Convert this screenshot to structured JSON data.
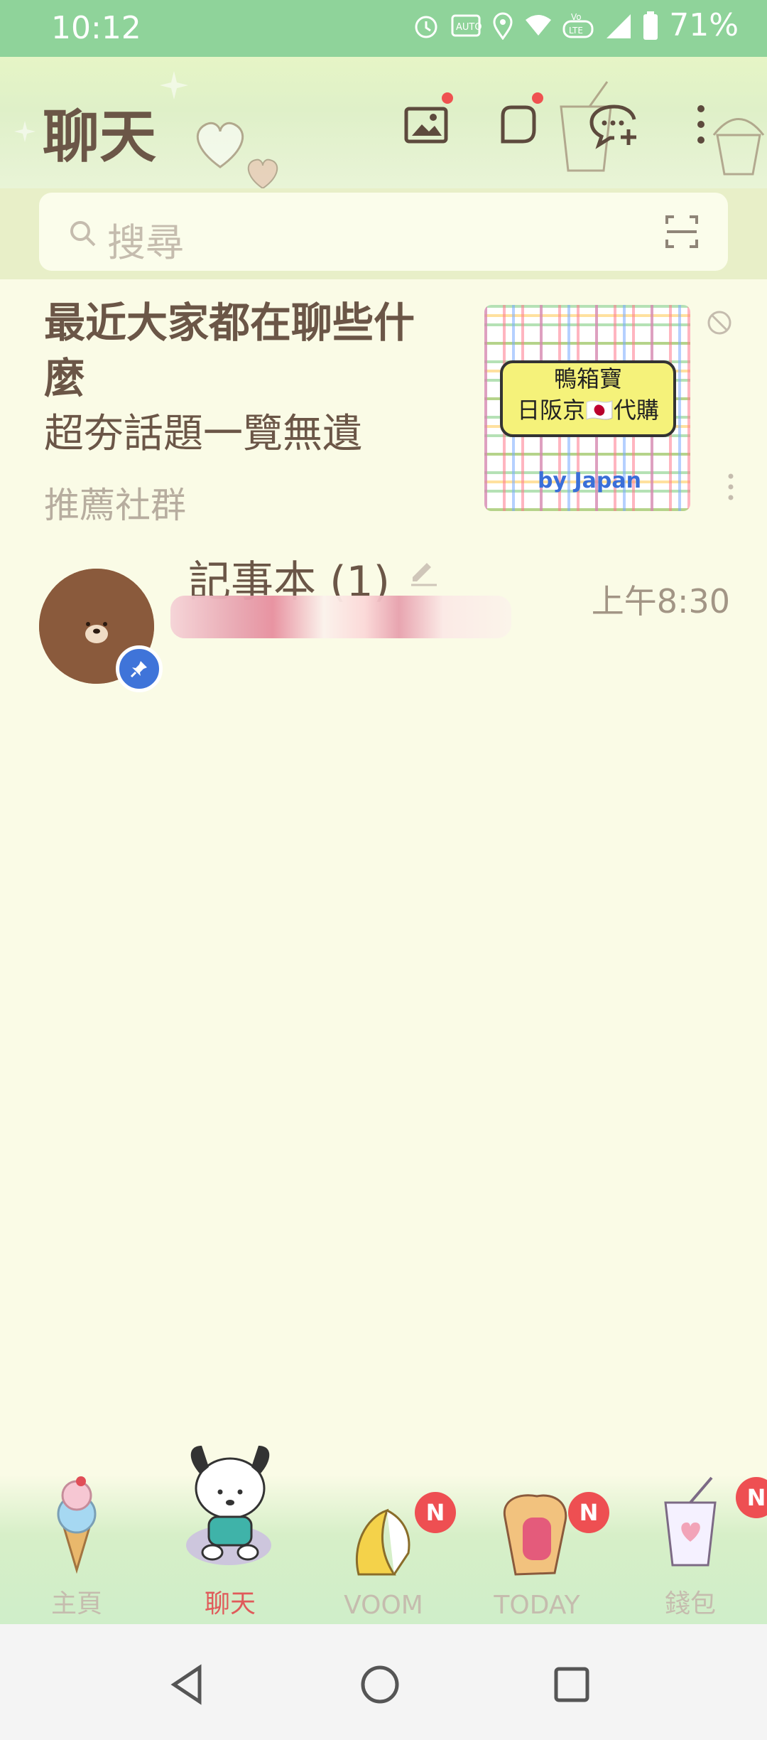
{
  "status_bar": {
    "time": "10:12",
    "battery_percent": "71%",
    "icons": [
      "alarm-icon",
      "auto-hz-icon",
      "location-icon",
      "wifi-icon",
      "volte-icon",
      "signal-icon",
      "battery-icon"
    ]
  },
  "header": {
    "title": "聊天",
    "actions": [
      "gallery-icon",
      "square-icon",
      "new-chat-icon",
      "more-icon"
    ]
  },
  "search": {
    "placeholder": "搜尋"
  },
  "recommendation": {
    "title": "最近大家都在聊些什麼",
    "subtitle": "超夯話題一覽無遺",
    "tag": "推薦社群",
    "thumbnail": {
      "line1": "鴨箱寶",
      "line2": "日阪京🇯🇵代購",
      "brand": "by Japan"
    }
  },
  "chats": [
    {
      "name": "記事本 (1)",
      "time": "上午8:30",
      "pinned": true
    }
  ],
  "bottom_nav": {
    "items": [
      {
        "label": "主頁",
        "badge": ""
      },
      {
        "label": "聊天",
        "badge": "",
        "active": true
      },
      {
        "label": "VOOM",
        "badge": "N"
      },
      {
        "label": "TODAY",
        "badge": "N"
      },
      {
        "label": "錢包",
        "badge": "N"
      }
    ]
  },
  "colors": {
    "status_bar": "#8fd39a",
    "background": "#fafbe6",
    "active_tab": "#e05a5a",
    "badge": "#ee4f52"
  }
}
